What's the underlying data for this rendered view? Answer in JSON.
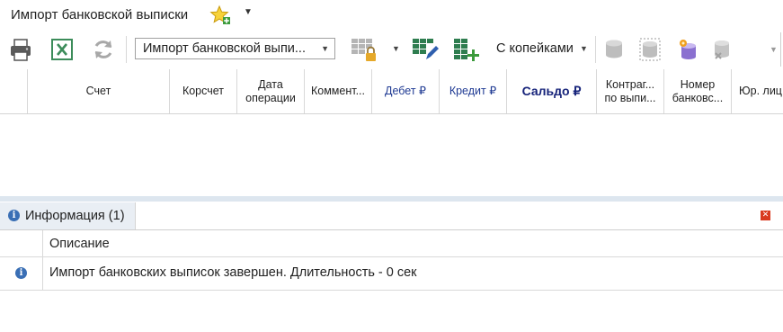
{
  "window": {
    "title": "Импорт банковской выписки",
    "favorite_icon": "star-add-icon",
    "title_menu_icon": "dropdown-arrow-icon"
  },
  "toolbar": {
    "print_icon": "printer-icon",
    "excel_icon": "excel-icon",
    "refresh_icon": "refresh-icon",
    "import_combo_value": "Импорт банковской выпи...",
    "grid_lock_icon": "grid-lock-icon",
    "grid_edit_icon": "grid-edit-icon",
    "grid_add_icon": "grid-add-icon",
    "kopecks_label": "С копейками",
    "db_icons": [
      "db-icon-disabled",
      "db-refresh-icon",
      "db-settings-icon",
      "db-delete-icon"
    ]
  },
  "grid": {
    "columns": [
      {
        "label": "Счет"
      },
      {
        "label": "Корсчет"
      },
      {
        "label": "Дата\nоперации"
      },
      {
        "label": "Коммент..."
      },
      {
        "label": "Дебет ₽"
      },
      {
        "label": "Кредит ₽"
      },
      {
        "label": "Сальдо ₽"
      },
      {
        "label": "Контраг...\nпо выпи..."
      },
      {
        "label": "Номер\nбанковс..."
      },
      {
        "label": "Юр. лиц"
      }
    ]
  },
  "info_panel": {
    "tab_label": "Информация (1)",
    "column_header": "Описание",
    "messages": [
      {
        "type": "info",
        "text": "Импорт банковских выписок завершен. Длительность - 0 сек"
      }
    ]
  },
  "colors": {
    "accent_blue": "#1f3a93",
    "divider": "#dde6ef",
    "close_red": "#d9391f"
  }
}
